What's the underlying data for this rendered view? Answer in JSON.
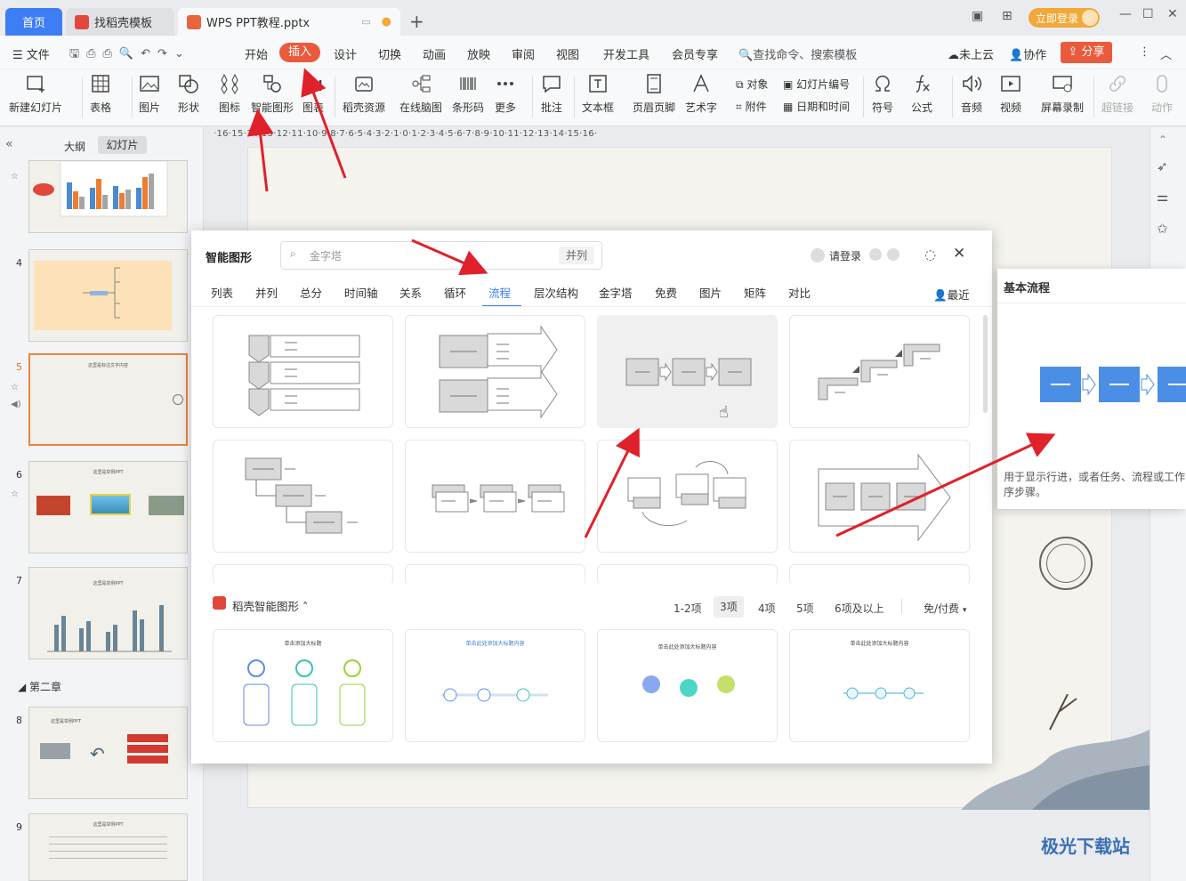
{
  "tabs": {
    "home": "首页",
    "template": "找稻壳模板",
    "doc": "WPS PPT教程.pptx"
  },
  "title_right": {
    "login": "立即登录"
  },
  "menu": {
    "file": "文件",
    "items": [
      "开始",
      "插入",
      "设计",
      "切换",
      "动画",
      "放映",
      "审阅",
      "视图",
      "开发工具",
      "会员专享"
    ],
    "search": "查找命令、搜索模板",
    "cloud": "未上云",
    "collab": "协作",
    "share": "分享"
  },
  "ribbon": {
    "new_slide": "新建幻灯片",
    "table": "表格",
    "picture": "图片",
    "shape": "形状",
    "icon": "图标",
    "smart": "智能图形",
    "chart": "图表",
    "docer": "稻壳资源",
    "mindmap": "在线脑图",
    "barcode": "条形码",
    "more": "更多",
    "comment": "批注",
    "textbox": "文本框",
    "header": "页眉页脚",
    "arttext": "艺术字",
    "object": "对象",
    "slide_num": "幻灯片编号",
    "attach": "附件",
    "datetime": "日期和时间",
    "symbol": "符号",
    "formula": "公式",
    "audio": "音频",
    "video": "视频",
    "screenrec": "屏幕录制",
    "hyperlink": "超链接",
    "action": "动作"
  },
  "leftpane": {
    "tab_outline": "大纲",
    "tab_slides": "幻灯片",
    "section": "第二章",
    "slides": [
      "4",
      "5",
      "6",
      "7",
      "8",
      "9"
    ],
    "slide_titles": {
      "5": "这里是标注文字内容",
      "6": "这里是举例PPT",
      "7": "这里是举例PPT",
      "8": "这里是举例PPT",
      "9": "这里是举例PPT"
    }
  },
  "ruler": "·16·15·14·13·12·11·10·9·8·7·6·5·4·3·2·1·0·1·2·3·4·5·6·7·8·9·10·11·12·13·14·15·16·",
  "dialog": {
    "title": "智能图形",
    "search_placeholder": "金字塔",
    "search_tag": "并列",
    "login": "请登录",
    "tabs": [
      "列表",
      "并列",
      "总分",
      "时间轴",
      "关系",
      "循环",
      "流程",
      "层次结构",
      "金字塔",
      "免费",
      "图片",
      "矩阵",
      "对比"
    ],
    "recent": "最近",
    "docer_label": "稻壳智能图形",
    "filters": [
      "1-2项",
      "3项",
      "4项",
      "5项",
      "6项及以上"
    ],
    "price": "免/付费",
    "template_titles": [
      "单击添加大标题",
      "单击此处添加大标题内容",
      "单击此处添加大标题内容",
      "单击此处添加大标题内容"
    ]
  },
  "preview": {
    "title": "基本流程",
    "desc": "用于显示行进，或者任务、流程或工作序步骤。"
  },
  "watermark": "极光下载站"
}
